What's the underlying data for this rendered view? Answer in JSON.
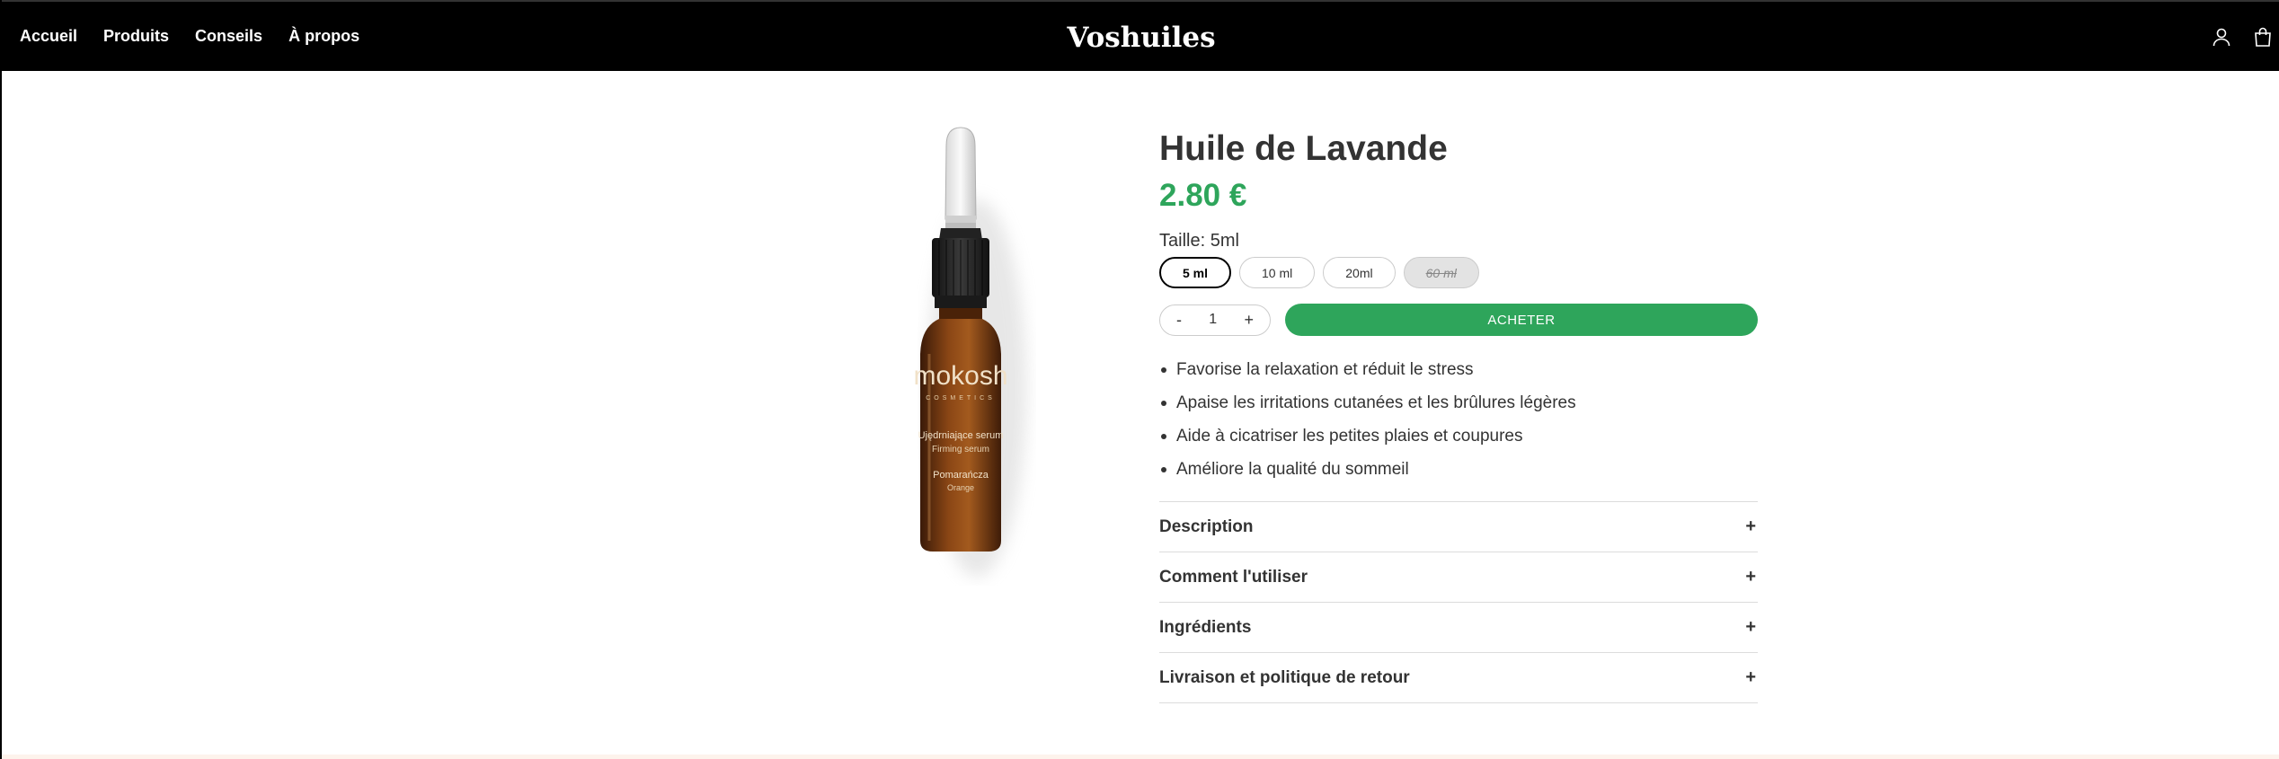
{
  "header": {
    "nav": [
      "Accueil",
      "Produits",
      "Conseils",
      "À propos"
    ],
    "logo": "Voshuiles",
    "icons": [
      "user-icon",
      "shopping-bag-icon"
    ]
  },
  "product": {
    "image": {
      "brand": "mokosh",
      "brand_sub": "COSMETICS",
      "line1": "Ujędrniające serum",
      "line2": "Firming serum",
      "line3": "Pomarańcza",
      "line4": "Orange"
    },
    "title": "Huile de Lavande",
    "price": "2.80 €",
    "size_label": "Taille: 5ml",
    "sizes": [
      {
        "label": "5 ml",
        "state": "selected"
      },
      {
        "label": "10 ml",
        "state": "available"
      },
      {
        "label": "20ml",
        "state": "available"
      },
      {
        "label": "60 ml",
        "state": "unavailable"
      }
    ],
    "quantity": {
      "minus": "-",
      "value": "1",
      "plus": "+"
    },
    "buy_label": "ACHETER",
    "benefits": [
      "Favorise la relaxation et réduit le stress",
      "Apaise les irritations cutanées et les brûlures légères",
      "Aide à cicatriser les petites plaies et coupures",
      "Améliore la qualité du sommeil"
    ],
    "accordion": [
      {
        "label": "Description",
        "icon": "+"
      },
      {
        "label": "Comment l'utiliser",
        "icon": "+"
      },
      {
        "label": "Ingrédients",
        "icon": "+"
      },
      {
        "label": "Livraison et politique de retour",
        "icon": "+"
      }
    ]
  },
  "colors": {
    "accent": "#2ea55b",
    "header_bg": "#000000",
    "text": "#333333"
  }
}
